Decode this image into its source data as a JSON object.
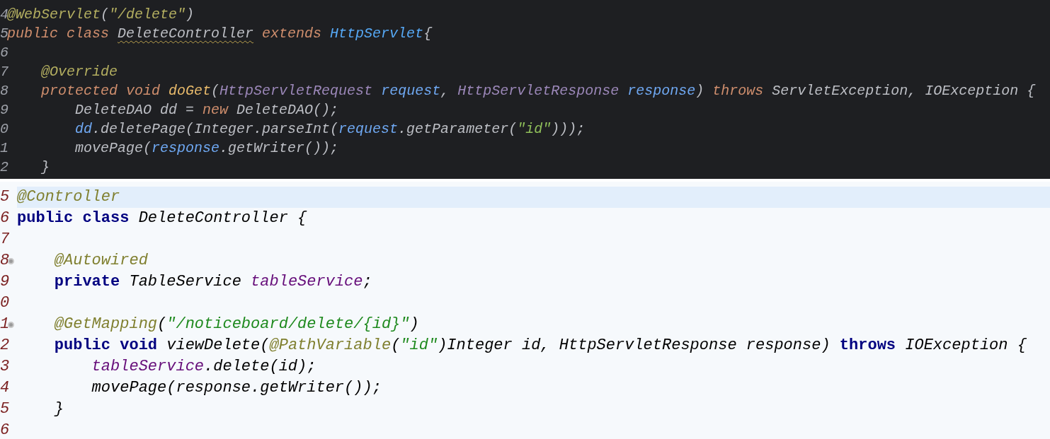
{
  "panels": [
    {
      "kind": "dark",
      "lines": [
        {
          "number": "4",
          "current": false,
          "fold_marker": false,
          "tokens": [
            {
              "text": "@WebServlet",
              "kind": "annotation"
            },
            {
              "text": "(",
              "kind": "plain"
            },
            {
              "text": "\"/delete\"",
              "kind": "annotation"
            },
            {
              "text": ")",
              "kind": "plain"
            }
          ]
        },
        {
          "number": "5",
          "current": false,
          "fold_marker": false,
          "tokens": [
            {
              "text": "public class ",
              "kind": "keyword"
            },
            {
              "text": "DeleteController",
              "kind": "warning"
            },
            {
              "text": " extends ",
              "kind": "keyword"
            },
            {
              "text": "HttpServlet",
              "kind": "reference"
            },
            {
              "text": "{",
              "kind": "plain"
            }
          ]
        },
        {
          "number": "6",
          "current": false,
          "fold_marker": false
        },
        {
          "number": "7",
          "current": false,
          "fold_marker": false,
          "tokens": [
            {
              "text": "    @Override",
              "kind": "annotation"
            }
          ]
        },
        {
          "number": "8",
          "current": false,
          "fold_marker": false,
          "tokens": [
            {
              "text": "    protected void ",
              "kind": "keyword"
            },
            {
              "text": "doGet",
              "kind": "method"
            },
            {
              "text": "(",
              "kind": "plain"
            },
            {
              "text": "HttpServletRequest ",
              "kind": "param-type"
            },
            {
              "text": "request",
              "kind": "variable"
            },
            {
              "text": ", ",
              "kind": "plain"
            },
            {
              "text": "HttpServletResponse ",
              "kind": "param-type"
            },
            {
              "text": "response",
              "kind": "variable"
            },
            {
              "text": ") ",
              "kind": "plain"
            },
            {
              "text": "throws",
              "kind": "keyword"
            },
            {
              "text": " ServletException, IOException {",
              "kind": "plain"
            }
          ]
        },
        {
          "number": "9",
          "current": false,
          "fold_marker": false,
          "tokens": [
            {
              "text": "        DeleteDAO dd = ",
              "kind": "plain"
            },
            {
              "text": "new",
              "kind": "keyword"
            },
            {
              "text": " DeleteDAO();",
              "kind": "plain"
            }
          ]
        },
        {
          "number": "0",
          "current": false,
          "fold_marker": false,
          "tokens": [
            {
              "text": "        dd",
              "kind": "variable"
            },
            {
              "text": ".deletePage(Integer.parseInt(",
              "kind": "plain"
            },
            {
              "text": "request",
              "kind": "variable"
            },
            {
              "text": ".getParameter(",
              "kind": "plain"
            },
            {
              "text": "\"id\"",
              "kind": "string"
            },
            {
              "text": ")));",
              "kind": "plain"
            }
          ]
        },
        {
          "number": "1",
          "current": false,
          "fold_marker": false,
          "tokens": [
            {
              "text": "        movePage(",
              "kind": "plain"
            },
            {
              "text": "response",
              "kind": "variable"
            },
            {
              "text": ".getWriter());",
              "kind": "plain"
            }
          ]
        },
        {
          "number": "2",
          "current": false,
          "fold_marker": false,
          "tokens": [
            {
              "text": "    }",
              "kind": "plain"
            }
          ]
        }
      ]
    },
    {
      "kind": "light",
      "lines": [
        {
          "number": "5",
          "current": true,
          "fold_marker": false,
          "tokens": [
            {
              "text": "@Controller",
              "kind": "annotation"
            }
          ]
        },
        {
          "number": "6",
          "current": false,
          "fold_marker": false,
          "tokens": [
            {
              "text": "public class ",
              "kind": "keyword"
            },
            {
              "text": "DeleteController {",
              "kind": "plain"
            }
          ]
        },
        {
          "number": "7",
          "current": false,
          "fold_marker": false
        },
        {
          "number": "8",
          "current": false,
          "fold_marker": true,
          "tokens": [
            {
              "text": "    @Autowired",
              "kind": "annotation"
            }
          ]
        },
        {
          "number": "9",
          "current": false,
          "fold_marker": false,
          "tokens": [
            {
              "text": "    private",
              "kind": "keyword"
            },
            {
              "text": " TableService ",
              "kind": "plain"
            },
            {
              "text": "tableService",
              "kind": "variable"
            },
            {
              "text": ";",
              "kind": "plain"
            }
          ]
        },
        {
          "number": "0",
          "current": false,
          "fold_marker": false
        },
        {
          "number": "1",
          "current": false,
          "fold_marker": true,
          "tokens": [
            {
              "text": "    @GetMapping",
              "kind": "annotation"
            },
            {
              "text": "(",
              "kind": "plain"
            },
            {
              "text": "\"/noticeboard/delete/{id}\"",
              "kind": "string"
            },
            {
              "text": ")",
              "kind": "plain"
            }
          ]
        },
        {
          "number": "2",
          "current": false,
          "fold_marker": false,
          "tokens": [
            {
              "text": "    public void",
              "kind": "keyword"
            },
            {
              "text": " viewDelete(",
              "kind": "plain"
            },
            {
              "text": "@PathVariable",
              "kind": "annotation"
            },
            {
              "text": "(",
              "kind": "plain"
            },
            {
              "text": "\"id\"",
              "kind": "string"
            },
            {
              "text": ")Integer id, HttpServletResponse response) ",
              "kind": "plain"
            },
            {
              "text": "throws",
              "kind": "keyword"
            },
            {
              "text": " IOException {",
              "kind": "plain"
            }
          ]
        },
        {
          "number": "3",
          "current": false,
          "fold_marker": false,
          "tokens": [
            {
              "text": "        tableService",
              "kind": "variable"
            },
            {
              "text": ".delete(id);",
              "kind": "plain"
            }
          ]
        },
        {
          "number": "4",
          "current": false,
          "fold_marker": false,
          "tokens": [
            {
              "text": "        movePage(response.getWriter());",
              "kind": "plain"
            }
          ]
        },
        {
          "number": "5",
          "current": false,
          "fold_marker": false,
          "tokens": [
            {
              "text": "    }",
              "kind": "plain"
            }
          ]
        },
        {
          "number": "6",
          "current": false,
          "fold_marker": false
        }
      ]
    }
  ]
}
